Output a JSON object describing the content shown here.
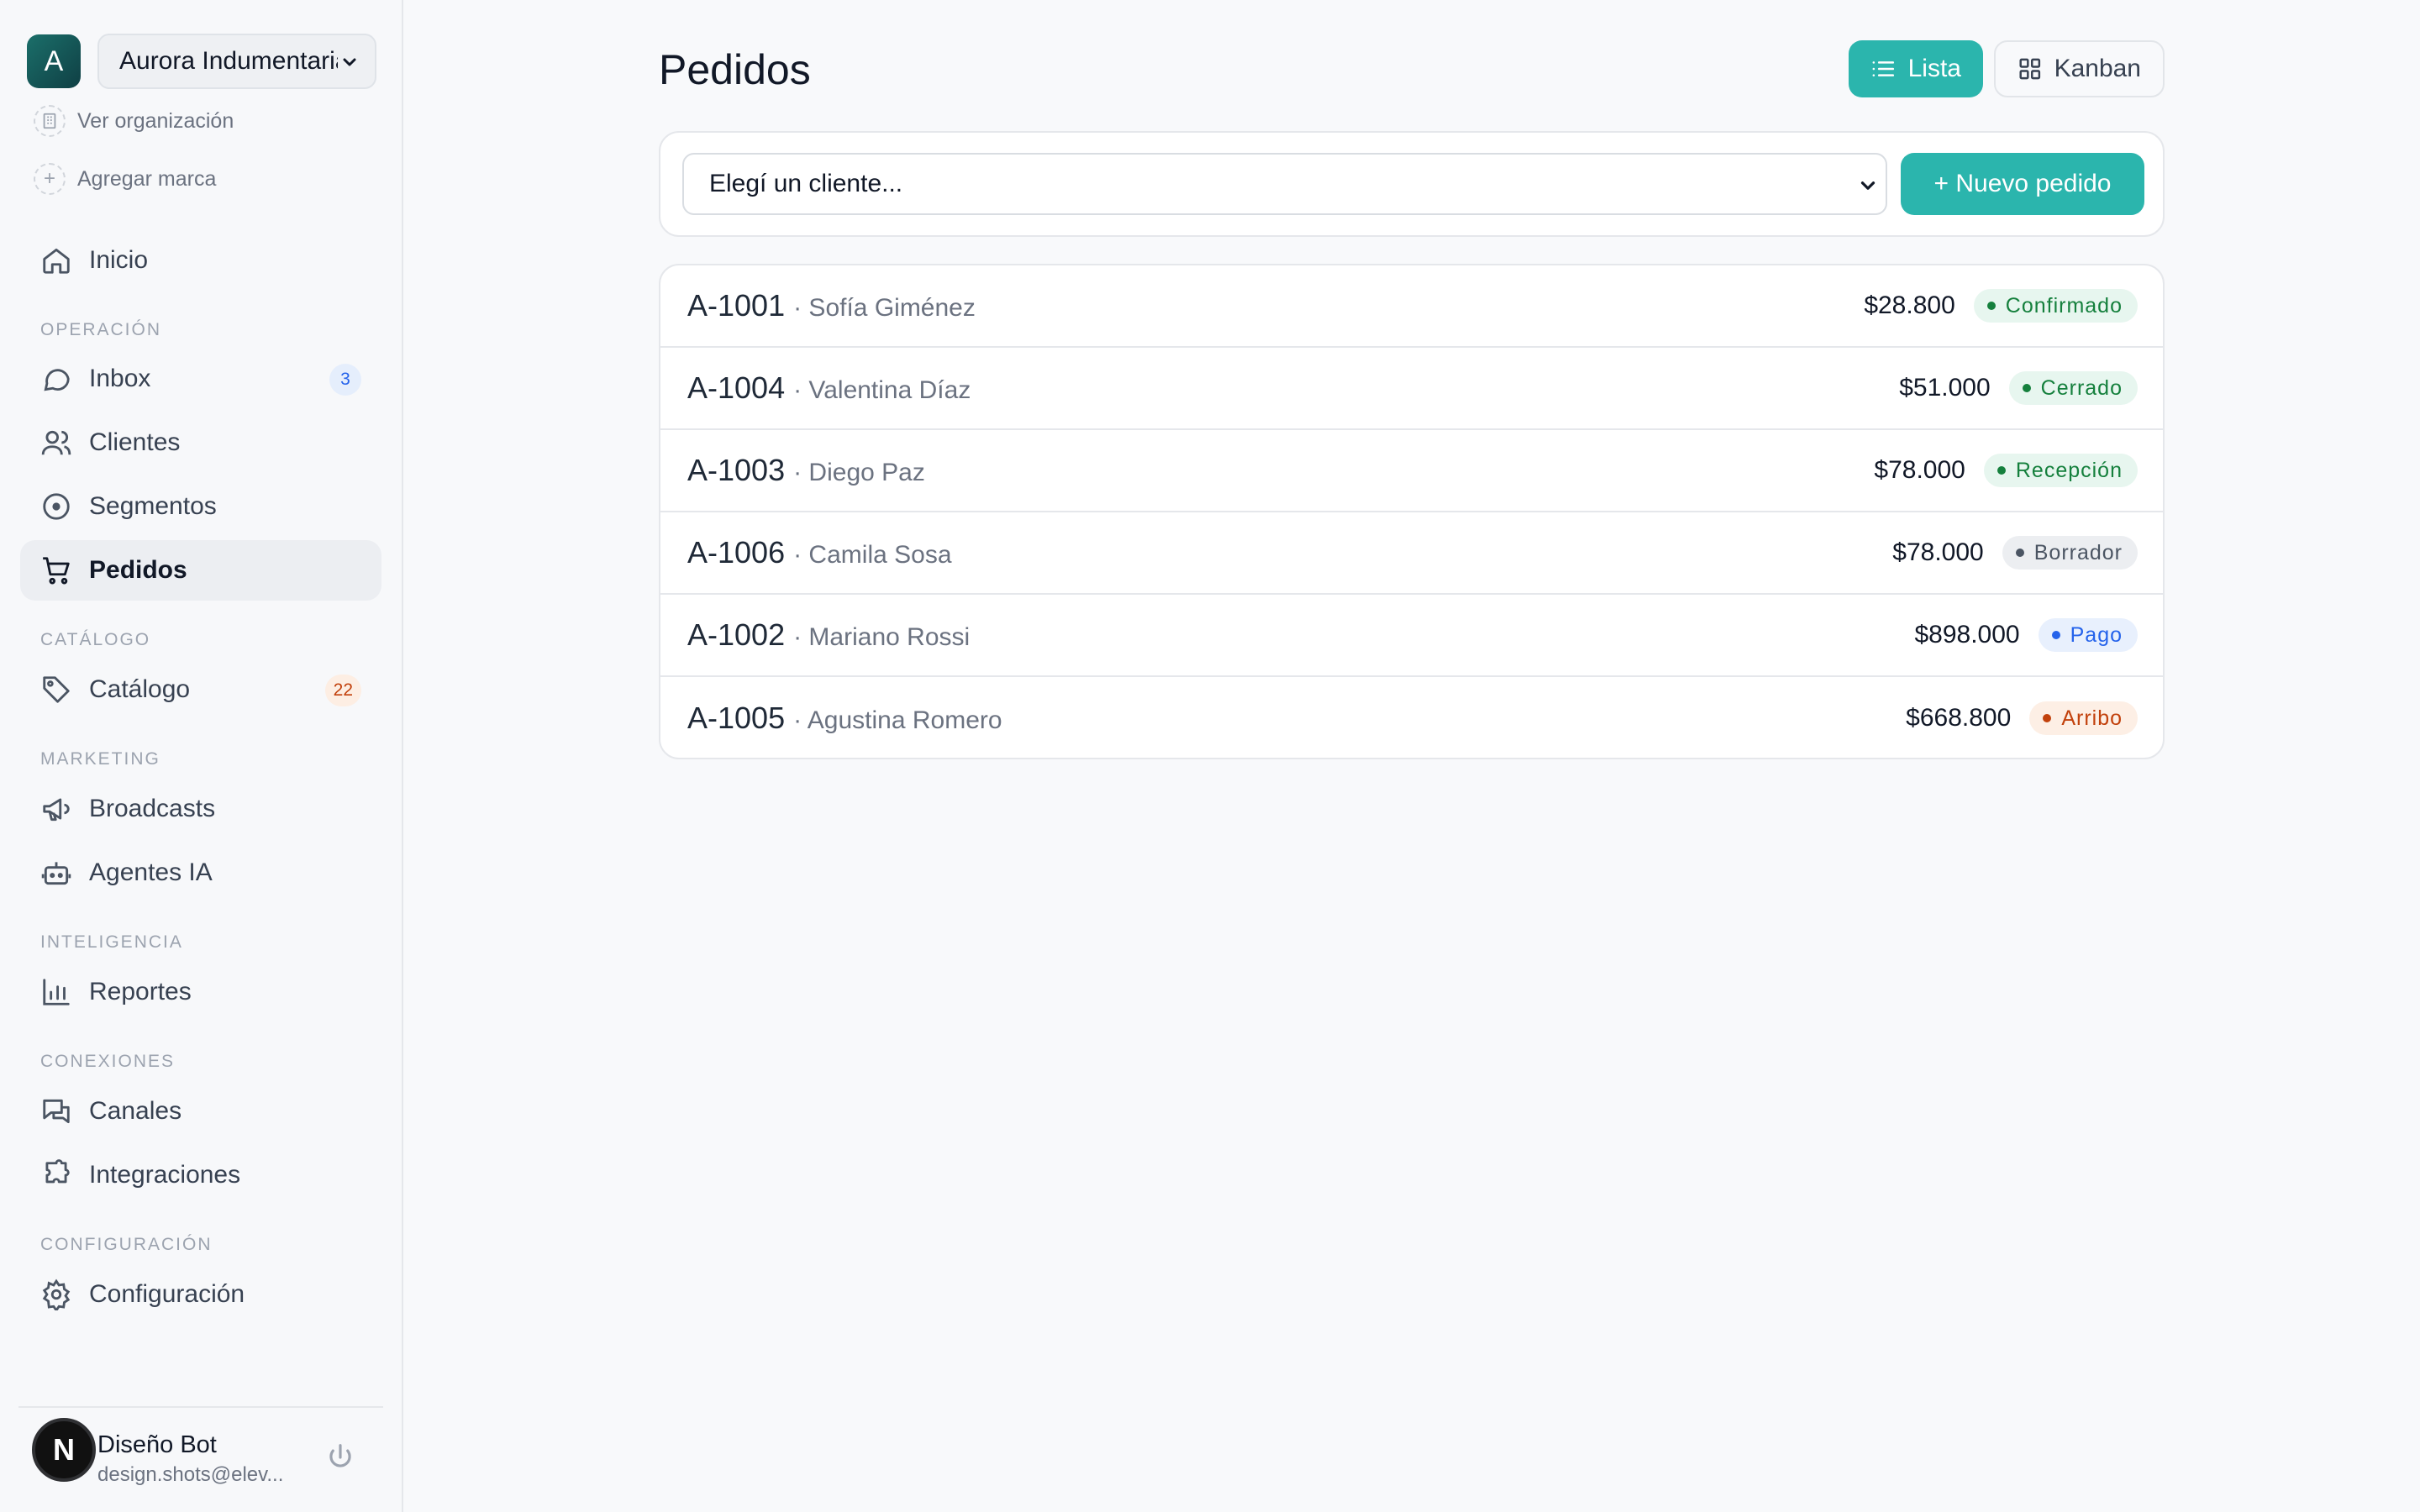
{
  "organization": {
    "avatar_letter": "A",
    "name": "Aurora Indumentaria",
    "view_org": "Ver organización",
    "add_brand": "Agregar marca"
  },
  "nav": {
    "home": "Inicio",
    "sections": {
      "operation": "OPERACIÓN",
      "catalog": "CATÁLOGO",
      "marketing": "MARKETING",
      "intelligence": "INTELIGENCIA",
      "connections": "CONEXIONES",
      "configuration": "CONFIGURACIÓN"
    },
    "inbox": {
      "label": "Inbox",
      "badge": "3"
    },
    "clients": "Clientes",
    "segments": "Segmentos",
    "orders": "Pedidos",
    "catalog": {
      "label": "Catálogo",
      "badge": "22"
    },
    "broadcasts": "Broadcasts",
    "ai_agents": "Agentes IA",
    "reports": "Reportes",
    "channels": "Canales",
    "integrations": "Integraciones",
    "settings": "Configuración"
  },
  "user": {
    "avatar_letter": "N",
    "name": "Diseño Bot",
    "email": "design.shots@elev..."
  },
  "main": {
    "title": "Pedidos",
    "view_list": "Lista",
    "view_kanban": "Kanban",
    "client_placeholder": "Elegí un cliente...",
    "new_order": "+ Nuevo pedido",
    "orders": [
      {
        "id": "A-1001",
        "client": "· Sofía Giménez",
        "amount": "$28.800",
        "status": "Confirmado",
        "status_color": "green"
      },
      {
        "id": "A-1004",
        "client": "· Valentina Díaz",
        "amount": "$51.000",
        "status": "Cerrado",
        "status_color": "green"
      },
      {
        "id": "A-1003",
        "client": "· Diego Paz",
        "amount": "$78.000",
        "status": "Recepción",
        "status_color": "green"
      },
      {
        "id": "A-1006",
        "client": "· Camila Sosa",
        "amount": "$78.000",
        "status": "Borrador",
        "status_color": "gray"
      },
      {
        "id": "A-1002",
        "client": "· Mariano Rossi",
        "amount": "$898.000",
        "status": "Pago",
        "status_color": "blue"
      },
      {
        "id": "A-1005",
        "client": "· Agustina Romero",
        "amount": "$668.800",
        "status": "Arribo",
        "status_color": "orange"
      }
    ]
  },
  "colors": {
    "accent": "#2bb5ad",
    "status_green": "#15803d",
    "status_blue": "#2563eb",
    "status_orange": "#c2410c",
    "status_gray": "#4b5563"
  }
}
